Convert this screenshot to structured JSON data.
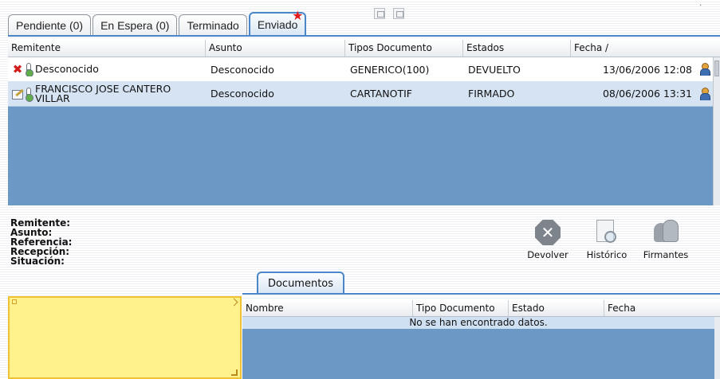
{
  "tabs": [
    {
      "label": "Pendiente (0)"
    },
    {
      "label": "En Espera (0)"
    },
    {
      "label": "Terminado"
    },
    {
      "label": "Enviado",
      "active": true
    }
  ],
  "columns": [
    "Remitente",
    "Asunto",
    "Tipos Documento",
    "Estados",
    "Fecha /"
  ],
  "rows": [
    {
      "remitente_lines": [
        "Desconocido"
      ],
      "asunto": "Desconocido",
      "tipo": "GENERICO(100)",
      "estado": "DEVUELTO",
      "fecha": "13/06/2006 12:08",
      "status_icon": "red-x-icon"
    },
    {
      "remitente_lines": [
        "FRANCISCO JOSE CANTERO",
        "VILLAR"
      ],
      "asunto": "Desconocido",
      "tipo": "CARTANOTIF",
      "estado": "FIRMADO",
      "fecha": "08/06/2006 13:31",
      "status_icon": "edit-document-icon"
    }
  ],
  "details": {
    "remitente": "Remitente:",
    "asunto": "Asunto:",
    "referencia": "Referencia:",
    "recepcion": "Recepción:",
    "situacion": "Situación:"
  },
  "actions": {
    "devolver": "Devolver",
    "historico": "Histórico",
    "firmantes": "Firmantes"
  },
  "documents": {
    "tab_label": "Documentos",
    "columns": [
      "Nombre",
      "Tipo Documento",
      "Estado",
      "Fecha"
    ],
    "empty_message": "No se han encontrado datos."
  },
  "colors": {
    "accent": "#4a86c8",
    "grid_body": "#6b98c4",
    "selected_row": "#d5e3f3",
    "note_panel": "#fff28c"
  }
}
